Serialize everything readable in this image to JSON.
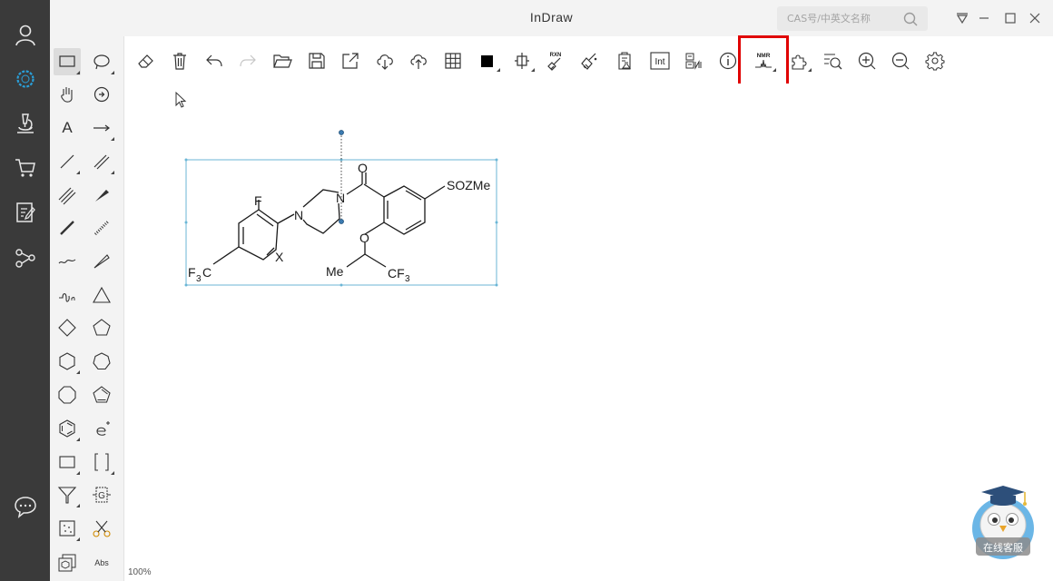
{
  "window": {
    "title": "InDraw"
  },
  "search": {
    "placeholder": "CAS号/中英文名称"
  },
  "palette": {
    "text_tool_glyph": "A",
    "abs_label": "Abs"
  },
  "toolbar": {
    "rxn_label": "RXN",
    "int_label": "Int",
    "nmr_label": "NMR"
  },
  "molecule": {
    "F": "F",
    "N1": "N",
    "N2": "N",
    "O_carbonyl": "O",
    "O_ether": "O",
    "X": "X",
    "SOZMe": "SOZMe",
    "Me": "Me",
    "CF3_right_main": "CF",
    "CF3_right_sub": "3",
    "CF3_left_main_a": "F",
    "CF3_left_sub": "3",
    "CF3_left_main_b": "C"
  },
  "status": {
    "zoom": "100%"
  },
  "service": {
    "label": "在线客服"
  },
  "colors": {
    "rail": "#3a3a3a",
    "accent_blue": "#2a9fd8",
    "highlight_red": "#e00000",
    "selection": "#6bb6d6"
  }
}
